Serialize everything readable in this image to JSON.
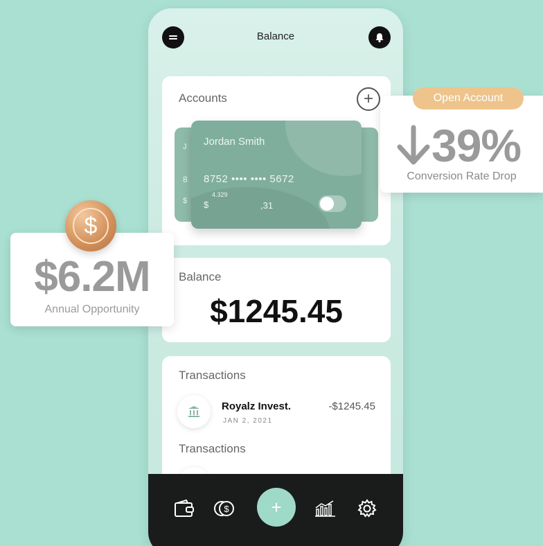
{
  "header": {
    "title": "Balance"
  },
  "accounts": {
    "label": "Accounts",
    "card": {
      "holder": "Jordan Smith",
      "number": "8752 •••• •••• 5672",
      "amount_currency": "$",
      "amount_top": "4.329",
      "amount_cents": ",31",
      "back_letters": [
        "J",
        "8",
        "$"
      ]
    }
  },
  "balance": {
    "label": "Balance",
    "amount": "$1245.45"
  },
  "transactions": {
    "label": "Transactions",
    "label2": "Transactions",
    "items": [
      {
        "name": "Royalz Invest.",
        "date": "JAN 2, 2021",
        "amount": "-$1245.45",
        "icon": "bank-icon"
      }
    ]
  },
  "bottom_nav": {
    "plus_label": "+",
    "icons": [
      "wallet-icon",
      "coin-icon",
      "plus-icon",
      "chart-icon",
      "gear-icon"
    ]
  },
  "opportunity": {
    "value": "$6.2M",
    "label": "Annual Opportunity",
    "badge_symbol": "$"
  },
  "conversion": {
    "value": "39%",
    "label": "Conversion Rate Drop",
    "pill": "Open Account"
  },
  "colors": {
    "background": "#a9e0d1",
    "card": "#7fae9d",
    "accent": "#9fd9c7",
    "pill": "#eec48c",
    "nav": "#1a1c1c"
  }
}
